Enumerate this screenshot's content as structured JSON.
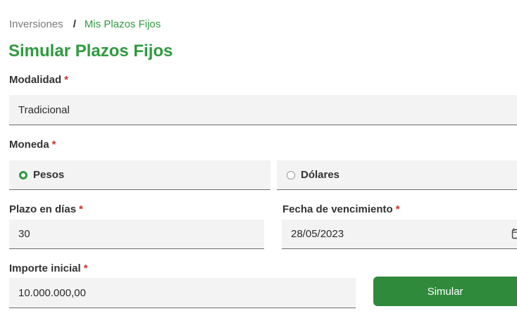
{
  "breadcrumb": {
    "parent": "Inversiones",
    "separator": "/",
    "current": "Mis Plazos Fijos"
  },
  "page": {
    "title": "Simular Plazos Fijos"
  },
  "form": {
    "required_mark": "*",
    "modalidad": {
      "label": "Modalidad",
      "value": "Tradicional"
    },
    "moneda": {
      "label": "Moneda",
      "options": [
        {
          "label": "Pesos",
          "selected": true
        },
        {
          "label": "Dólares",
          "selected": false
        }
      ]
    },
    "plazo": {
      "label": "Plazo en días",
      "value": "30"
    },
    "vencimiento": {
      "label": "Fecha de vencimiento",
      "value": "28/05/2023",
      "icon": "calendar-icon"
    },
    "importe": {
      "label": "Importe inicial",
      "value": "10.000.000,00"
    }
  },
  "actions": {
    "simulate_label": "Simular"
  },
  "colors": {
    "accent": "#2f9a3f",
    "button": "#2f8a3b",
    "required": "#d32f2f",
    "field_bg": "#f3f3f3"
  }
}
